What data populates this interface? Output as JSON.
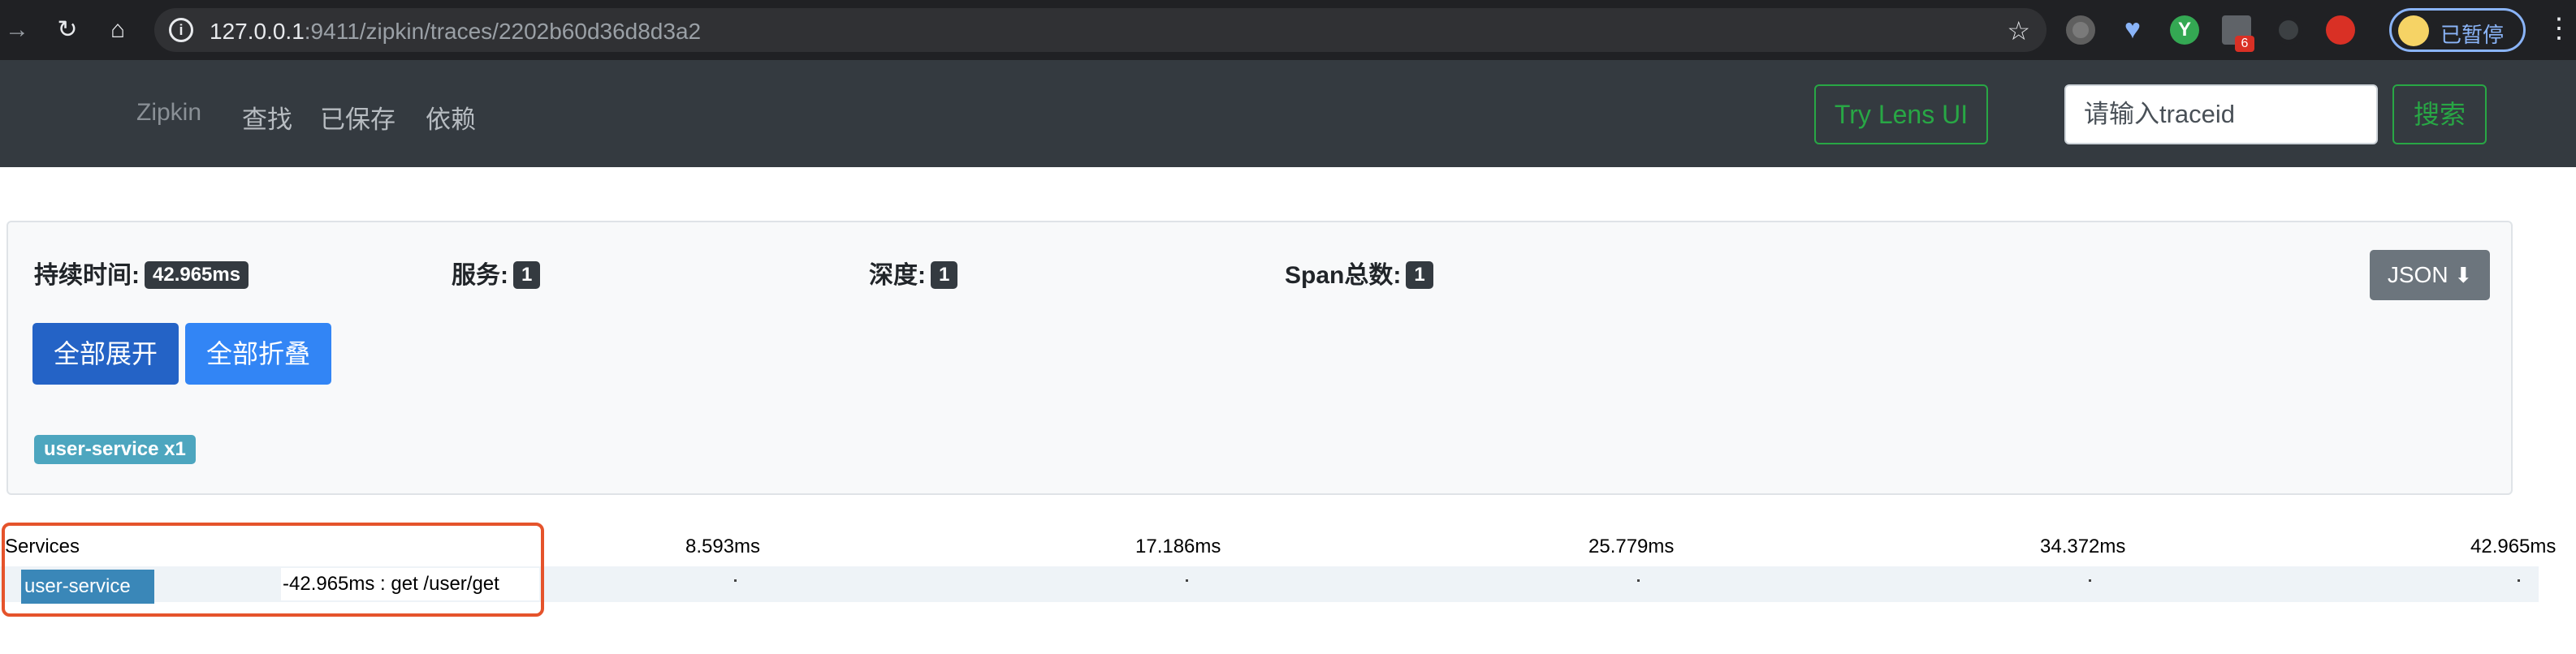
{
  "browser": {
    "url_host": "127.0.0.1",
    "url_rest": ":9411/zipkin/traces/2202b60d36d8d3a2",
    "ext_badge": "6",
    "profile_name": "已暂停"
  },
  "navbar": {
    "brand": "Zipkin",
    "links": [
      "查找",
      "已保存",
      "依赖"
    ],
    "try_lens": "Try Lens UI",
    "trace_placeholder": "请输入traceid",
    "search": "搜索"
  },
  "summary": {
    "duration_label": "持续时间:",
    "duration_value": "42.965ms",
    "services_label": "服务:",
    "services_value": "1",
    "depth_label": "深度:",
    "depth_value": "1",
    "spans_label": "Span总数:",
    "spans_value": "1",
    "json_button": "JSON",
    "expand_all": "全部展开",
    "collapse_all": "全部折叠",
    "service_tag": "user-service x1"
  },
  "timeline": {
    "header": "Services",
    "ticks": [
      "8.593ms",
      "17.186ms",
      "25.779ms",
      "34.372ms",
      "42.965ms"
    ],
    "service": "user-service",
    "span_label": "-42.965ms : get /user/get"
  },
  "colors": {
    "navbar_bg": "#343a40",
    "green": "#28a745",
    "blue_primary": "#2463c6",
    "blue_secondary": "#3285f5",
    "service_bar": "#3a87b8",
    "highlight": "#e5532b"
  }
}
